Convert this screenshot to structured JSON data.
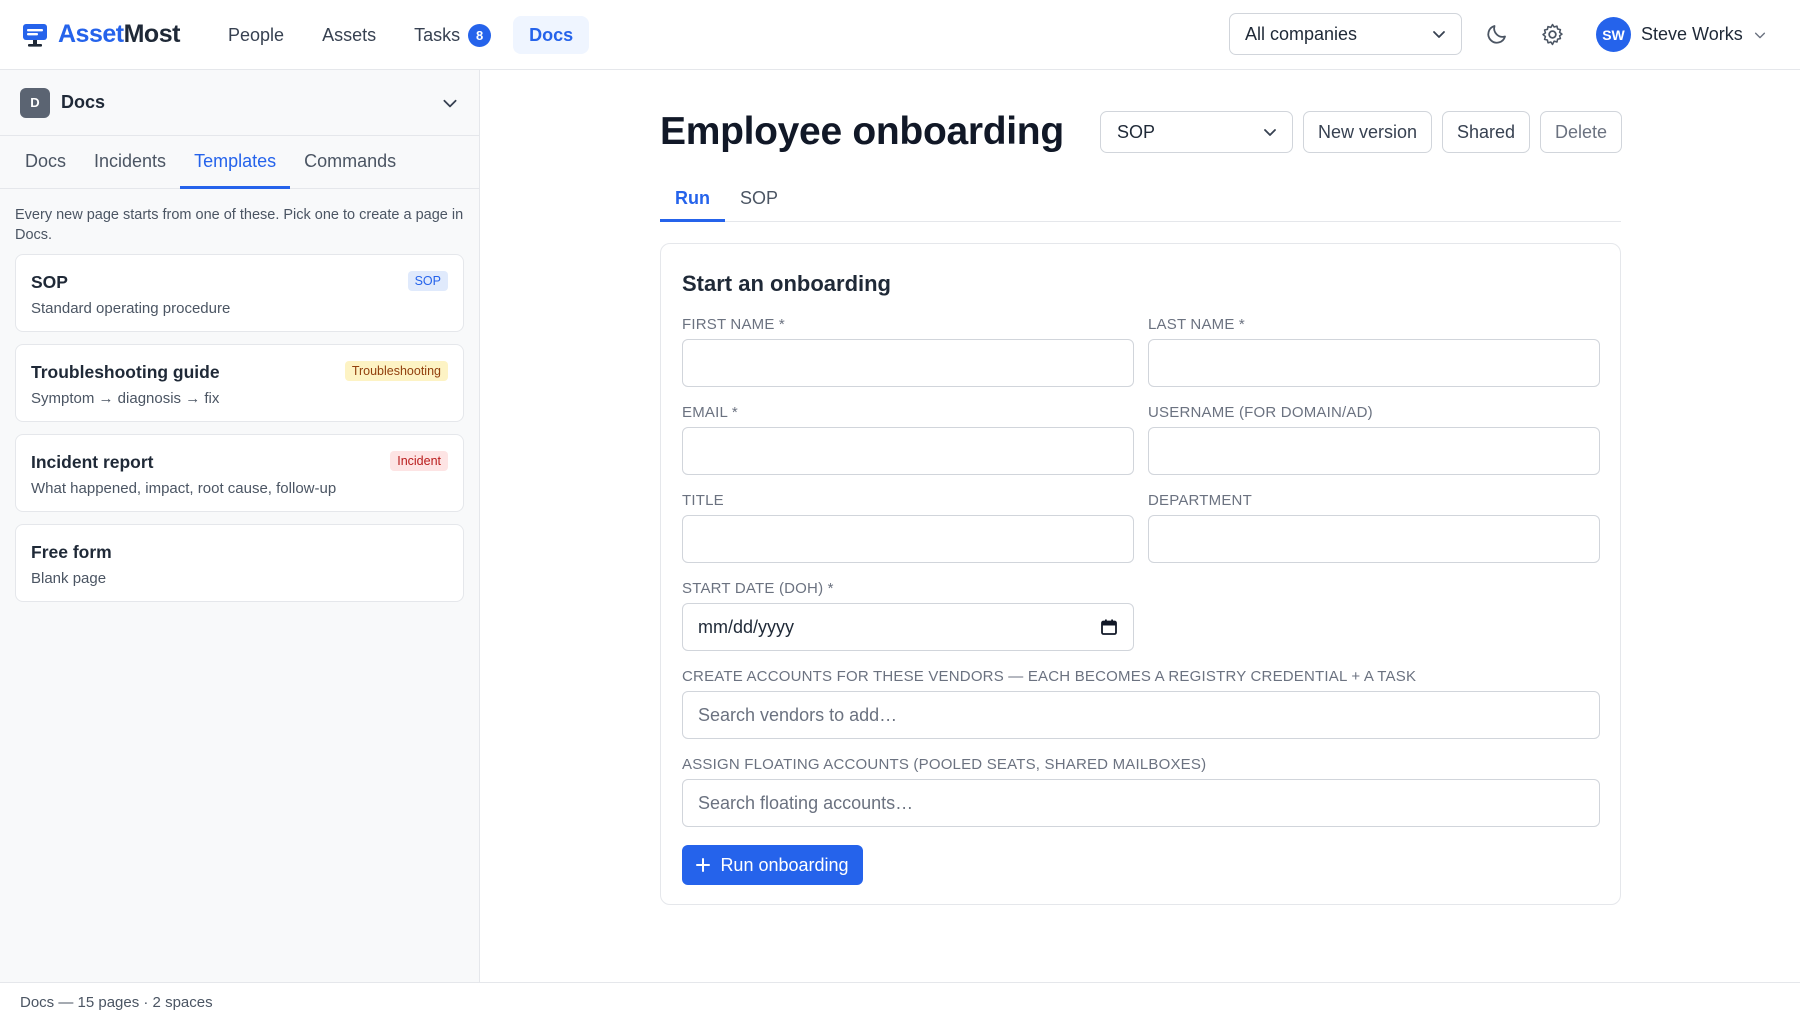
{
  "app": {
    "name_part1": "Asset",
    "name_part2": "Most"
  },
  "nav": {
    "people": "People",
    "assets": "Assets",
    "tasks": "Tasks",
    "tasks_count": "8",
    "docs": "Docs"
  },
  "company_select": {
    "value": "All companies"
  },
  "user": {
    "initials": "SW",
    "name": "Steve Works"
  },
  "sidebar": {
    "space_icon": "D",
    "space_name": "Docs",
    "tabs": [
      "Docs",
      "Incidents",
      "Templates",
      "Commands"
    ],
    "active_tab": "Templates",
    "hint": "Every new page starts from one of these. Pick one to create a page in Docs.",
    "templates": [
      {
        "name": "SOP",
        "desc": "Standard operating procedure",
        "tag": "SOP"
      },
      {
        "name": "Troubleshooting guide",
        "desc": "Symptom → diagnosis → fix",
        "tag": "Troubleshooting"
      },
      {
        "name": "Incident report",
        "desc": "What happened, impact, root cause, follow-up",
        "tag": "Incident"
      },
      {
        "name": "Free form",
        "desc": "Blank page",
        "tag": ""
      }
    ]
  },
  "page": {
    "title": "Employee onboarding",
    "type_value": "SOP",
    "new_version": "New version",
    "shared": "Shared",
    "delete": "Delete",
    "tabs": [
      "Run",
      "SOP"
    ]
  },
  "form": {
    "title": "Start an onboarding",
    "first_name_label": "FIRST NAME *",
    "last_name_label": "LAST NAME *",
    "email_label": "EMAIL *",
    "username_label": "USERNAME (FOR DOMAIN/AD)",
    "title_label": "TITLE",
    "department_label": "DEPARTMENT",
    "start_date_label": "START DATE (DOH) *",
    "start_date_placeholder": "mm/dd/yyyy",
    "vendors_label": "CREATE ACCOUNTS FOR THESE VENDORS — EACH BECOMES A REGISTRY CREDENTIAL + A TASK",
    "vendors_placeholder": "Search vendors to add…",
    "floating_label": "ASSIGN FLOATING ACCOUNTS (POOLED SEATS, SHARED MAILBOXES)",
    "floating_placeholder": "Search floating accounts…",
    "submit": "Run onboarding"
  },
  "footer": {
    "text": "Docs — 15 pages · 2 spaces"
  },
  "colors": {
    "accent": "#2563eb",
    "tag_sop_bg": "#e0eafc",
    "tag_sop_fg": "#2563eb",
    "tag_troubleshooting_bg": "#fdf3c4",
    "tag_troubleshooting_fg": "#92400e",
    "tag_incident_bg": "#fde4e4",
    "tag_incident_fg": "#b91c1c"
  }
}
